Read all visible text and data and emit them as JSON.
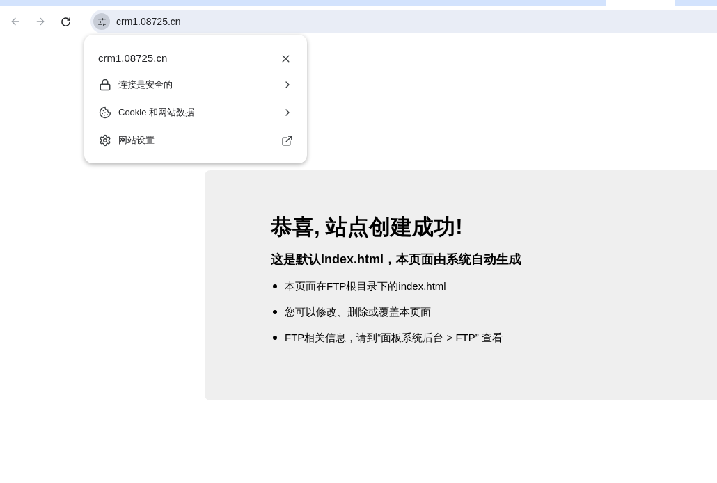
{
  "address_bar": {
    "url": "crm1.08725.cn"
  },
  "site_info_popup": {
    "title": "crm1.08725.cn",
    "items": [
      {
        "kind": "submenu",
        "label": "连接是安全的"
      },
      {
        "kind": "submenu",
        "label": "Cookie 和网站数据"
      },
      {
        "kind": "external",
        "label": "网站设置"
      }
    ]
  },
  "page": {
    "heading": "恭喜, 站点创建成功!",
    "subheading": "这是默认index.html，本页面由系统自动生成",
    "bullets": [
      "本页面在FTP根目录下的index.html",
      "您可以修改、删除或覆盖本页面",
      "FTP相关信息，请到“面板系统后台 > FTP” 查看"
    ]
  }
}
